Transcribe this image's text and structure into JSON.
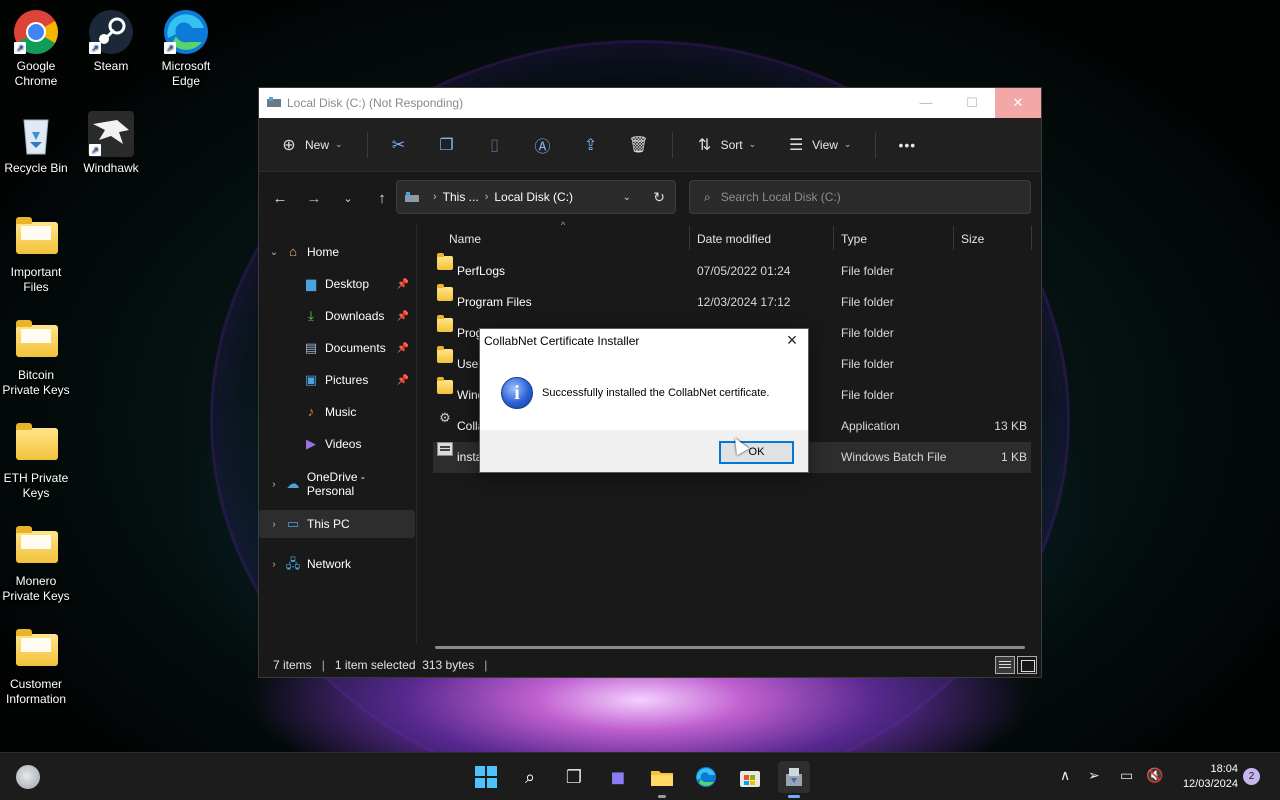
{
  "desktop": {
    "icons": [
      {
        "label": "Google Chrome",
        "icon": "chrome-icon"
      },
      {
        "label": "Steam",
        "icon": "steam-icon"
      },
      {
        "label": "Microsoft Edge",
        "icon": "edge-icon"
      },
      {
        "label": "Recycle Bin",
        "icon": "recycle-bin-icon"
      },
      {
        "label": "Windhawk",
        "icon": "windhawk-icon"
      },
      {
        "label": "Important Files",
        "icon": "folder-icon"
      },
      {
        "label": "Bitcoin Private Keys",
        "icon": "folder-icon"
      },
      {
        "label": "ETH Private Keys",
        "icon": "folder-icon"
      },
      {
        "label": "Monero Private Keys",
        "icon": "folder-icon"
      },
      {
        "label": "Customer Information",
        "icon": "folder-icon"
      }
    ]
  },
  "explorer": {
    "title": "Local Disk (C:) (Not Responding)",
    "toolbar": {
      "new_label": "New",
      "sort_label": "Sort",
      "view_label": "View",
      "more_label": "•••"
    },
    "breadcrumb": {
      "part1": "This ...",
      "part2": "Local Disk (C:)"
    },
    "search_placeholder": "Search Local Disk (C:)",
    "sidebar": {
      "items": [
        {
          "label": "Home",
          "icon": "home-icon"
        },
        {
          "label": "Desktop",
          "icon": "desktop-icon"
        },
        {
          "label": "Downloads",
          "icon": "download-icon"
        },
        {
          "label": "Documents",
          "icon": "documents-icon"
        },
        {
          "label": "Pictures",
          "icon": "pictures-icon"
        },
        {
          "label": "Music",
          "icon": "music-icon"
        },
        {
          "label": "Videos",
          "icon": "videos-icon"
        },
        {
          "label": "OneDrive - Personal",
          "icon": "cloud-icon"
        },
        {
          "label": "This PC",
          "icon": "computer-icon"
        },
        {
          "label": "Network",
          "icon": "network-icon"
        }
      ]
    },
    "columns": {
      "name": "Name",
      "date": "Date modified",
      "type": "Type",
      "size": "Size"
    },
    "files": [
      {
        "name": "PerfLogs",
        "date": "07/05/2022 01:24",
        "type": "File folder",
        "size": "",
        "icon": "folder-icon"
      },
      {
        "name": "Program Files",
        "date": "12/03/2024 17:12",
        "type": "File folder",
        "size": "",
        "icon": "folder-icon"
      },
      {
        "name": "Prog",
        "date": "",
        "type": "File folder",
        "size": "",
        "icon": "folder-icon"
      },
      {
        "name": "User",
        "date": "",
        "type": "File folder",
        "size": "",
        "icon": "folder-icon"
      },
      {
        "name": "Wind",
        "date": "",
        "type": "File folder",
        "size": "",
        "icon": "folder-icon"
      },
      {
        "name": "Colla",
        "date": "",
        "type": "Application",
        "size": "13 KB",
        "icon": "application-icon"
      },
      {
        "name": "insta",
        "date": "",
        "type": "Windows Batch File",
        "size": "1 KB",
        "icon": "batch-file-icon"
      }
    ],
    "status": {
      "count": "7 items",
      "selection": "1 item selected  313 bytes"
    }
  },
  "dialog": {
    "title": "CollabNet Certificate Installer",
    "message": "Successfully installed the CollabNet certificate.",
    "ok_label": "OK",
    "icon": "information-icon"
  },
  "taskbar": {
    "time": "18:04",
    "date": "12/03/2024",
    "notification_count": "2"
  }
}
